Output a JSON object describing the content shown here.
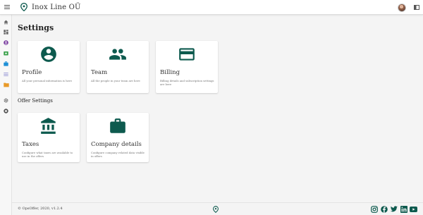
{
  "colors": {
    "accent": "#0d5a4e",
    "card_bg": "#ffffff",
    "page_bg": "#f4f4f4"
  },
  "header": {
    "company_name": "Inox Line OÜ",
    "menu_icon": "hamburger-icon",
    "brand_icon": "location-pin-icon"
  },
  "sidebar": {
    "items": [
      {
        "icon": "home-icon"
      },
      {
        "icon": "dashboard-icon"
      },
      {
        "icon": "user-circle-icon"
      },
      {
        "icon": "money-icon"
      },
      {
        "icon": "briefcase-icon"
      },
      {
        "icon": "list-icon"
      },
      {
        "icon": "folder-icon"
      },
      {
        "icon": "gear-icon"
      },
      {
        "icon": "help-icon"
      }
    ]
  },
  "page": {
    "title": "Settings",
    "offer_section_title": "Offer Settings"
  },
  "cards": {
    "profile": {
      "icon": "account-circle-icon",
      "title": "Profile",
      "desc": "All your personal information is here"
    },
    "team": {
      "icon": "people-icon",
      "title": "Team",
      "desc": "All the people in your team are here"
    },
    "billing": {
      "icon": "credit-card-icon",
      "title": "Billing",
      "desc": "Billing details and subscription settings are here"
    },
    "taxes": {
      "icon": "bank-icon",
      "title": "Taxes",
      "desc": "Configure what taxes are available to use in the offers"
    },
    "company": {
      "icon": "work-briefcase-icon",
      "title": "Company details",
      "desc": "Configure company related data visible in offers"
    }
  },
  "footer": {
    "copyright": "© OpsOffer, 2020, v1.2.4",
    "socials": [
      "instagram-icon",
      "facebook-icon",
      "twitter-icon",
      "linkedin-icon",
      "youtube-icon"
    ]
  }
}
